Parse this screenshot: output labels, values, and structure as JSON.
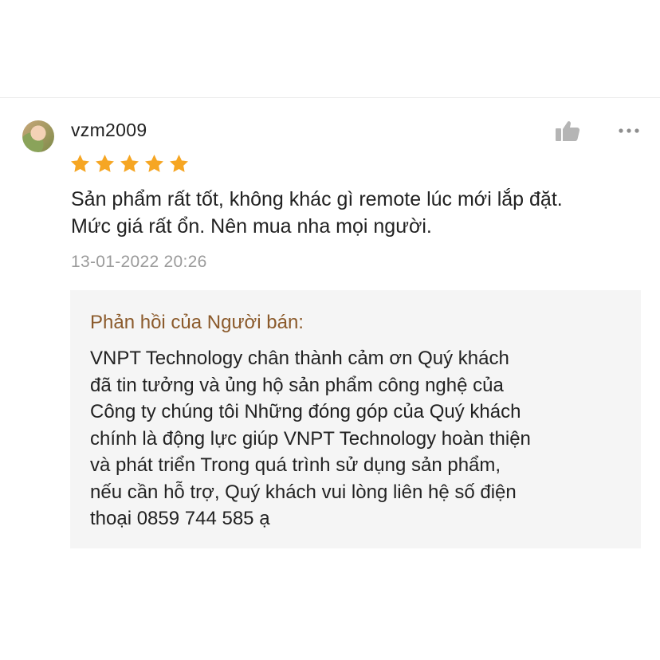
{
  "review": {
    "username": "vzm2009",
    "rating": 5,
    "rating_max": 5,
    "star_color": "#f6a623",
    "comment_lines": [
      "Sản phẩm rất tốt, không khác gì remote lúc mới lắp đặt.",
      "Mức giá rất ổn.  Nên mua nha mọi người."
    ],
    "timestamp": "13-01-2022 20:26",
    "icons": {
      "like": "thumbs-up-icon",
      "more": "more-options-icon"
    }
  },
  "seller_reply": {
    "title": "Phản hồi của Người bán:",
    "title_color": "#8b5a2b",
    "lines": [
      "VNPT Technology chân thành cảm ơn Quý khách",
      "đã tin tưởng và ủng hộ sản phẩm công nghệ của",
      "Công ty chúng tôi Những đóng góp của Quý khách",
      "chính là động lực giúp VNPT Technology hoàn thiện",
      "và phát triển Trong quá trình sử dụng sản phẩm,",
      "nếu cần hỗ trợ, Quý khách vui lòng liên hệ số điện",
      "thoại 0859 744 585 ạ"
    ]
  }
}
